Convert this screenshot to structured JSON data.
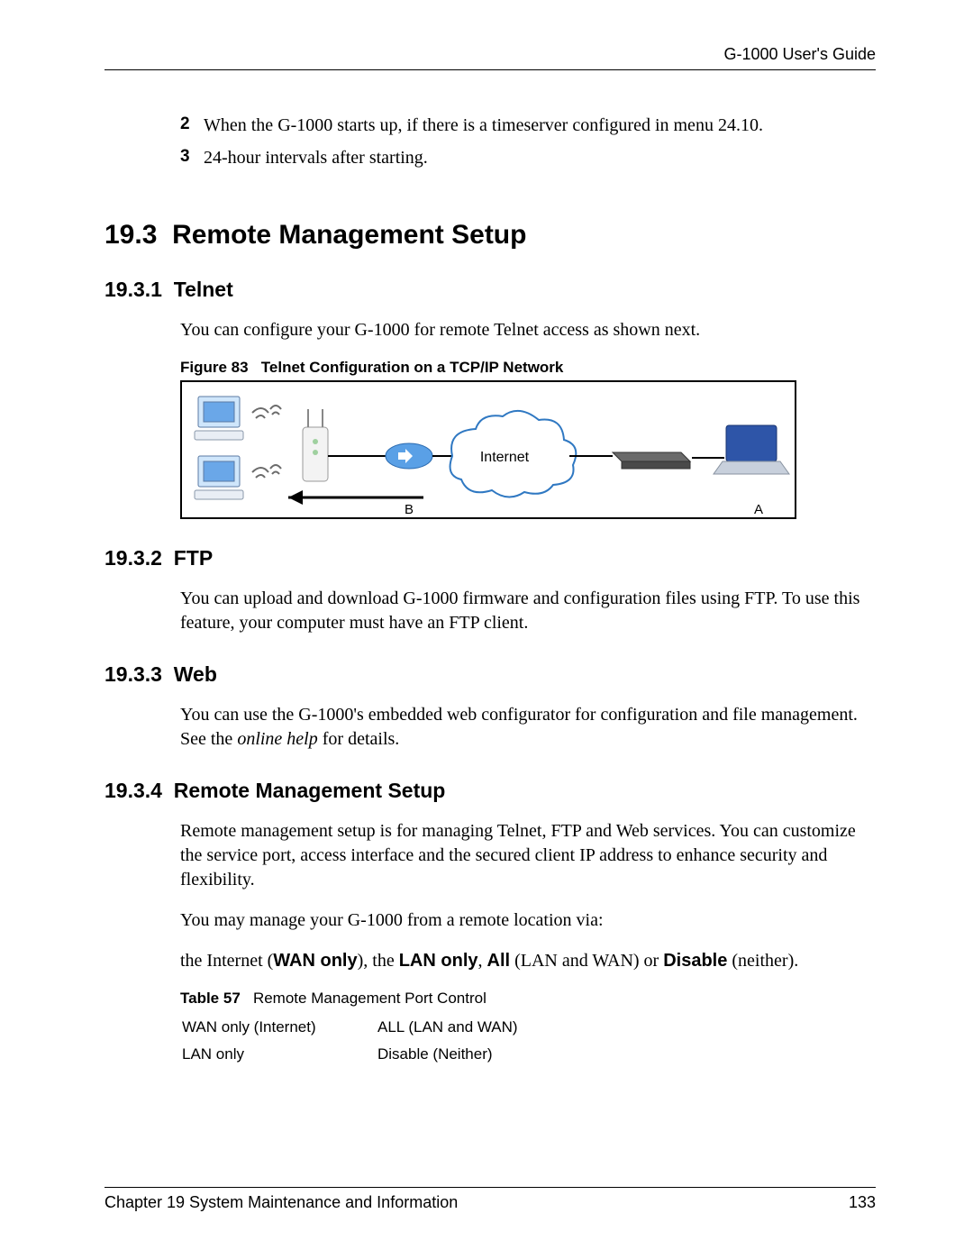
{
  "header": {
    "title": "G-1000 User's Guide"
  },
  "intro_list": [
    {
      "num": "2",
      "text": "When the G-1000 starts up, if there is a timeserver configured in menu 24.10."
    },
    {
      "num": "3",
      "text": "24-hour intervals after starting."
    }
  ],
  "section": {
    "number": "19.3",
    "title": "Remote Management Setup"
  },
  "s1": {
    "heading_num": "19.3.1",
    "heading_title": "Telnet",
    "text": "You can configure your G-1000 for remote Telnet access as shown next.",
    "fig_label": "Figure 83",
    "fig_title": "Telnet Configuration on a TCP/IP Network",
    "diagram": {
      "internet": "Internet",
      "a": "A",
      "b": "B"
    }
  },
  "s2": {
    "heading_num": "19.3.2",
    "heading_title": "FTP",
    "text": "You can upload and download G-1000 firmware and configuration files using FTP. To use this feature, your computer must have an FTP client."
  },
  "s3": {
    "heading_num": "19.3.3",
    "heading_title": "Web",
    "pre": "You can use the G-1000's embedded web configurator for configuration and file management. See the ",
    "italic": "online help",
    "post": " for details."
  },
  "s4": {
    "heading_num": "19.3.4",
    "heading_title": "Remote Management Setup",
    "p1": "Remote management setup is for managing Telnet, FTP and Web services. You can customize the service port, access interface and the secured client IP address to enhance security and flexibility.",
    "p2": "You may manage your G-1000 from a remote location via:",
    "p3_pre": " the Internet (",
    "p3_b1": "WAN only",
    "p3_mid1": "), the ",
    "p3_b2": "LAN only",
    "p3_mid2": ", ",
    "p3_b3": "All",
    "p3_mid3": " (LAN and WAN) or ",
    "p3_b4": "Disable",
    "p3_post": " (neither).",
    "tbl_label": "Table 57",
    "tbl_title": "Remote Management Port Control",
    "cells": {
      "r1c1": "WAN only (Internet)",
      "r1c2": "ALL (LAN and WAN)",
      "r2c1": "LAN only",
      "r2c2": "Disable (Neither)"
    }
  },
  "footer": {
    "left": "Chapter 19 System Maintenance and Information",
    "right": "133"
  }
}
